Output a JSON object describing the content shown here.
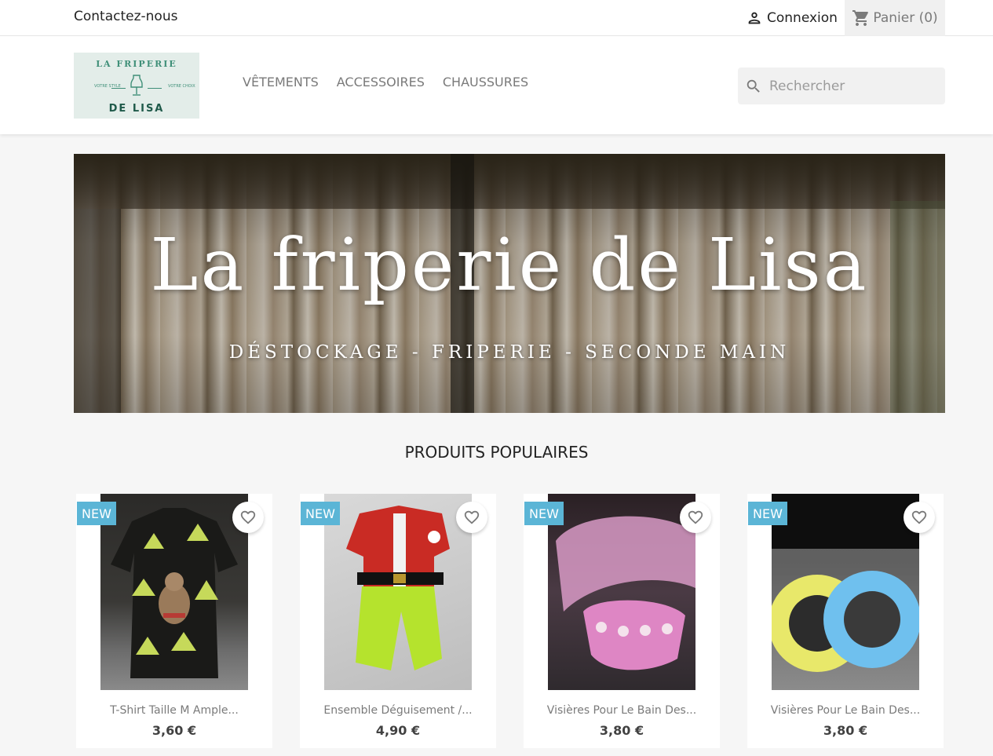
{
  "topbar": {
    "contact": "Contactez-nous",
    "login": "Connexion",
    "cart": "Panier (0)"
  },
  "header": {
    "logo": {
      "top": "LA FRIPERIE",
      "bottom": "DE LISA",
      "left_small": "VOTRE STYLE",
      "right_small": "VOTRE CHOIX"
    },
    "menu": [
      "VÊTEMENTS",
      "ACCESSOIRES",
      "CHAUSSURES"
    ],
    "search_placeholder": "Rechercher"
  },
  "banner": {
    "title": "La friperie de Lisa",
    "subtitle": "DÉSTOCKAGE - FRIPERIE - SECONDE MAIN"
  },
  "section_title": "PRODUITS POPULAIRES",
  "products": [
    {
      "badge": "NEW",
      "name": "T-Shirt Taille M Ample...",
      "price": "3,60 €"
    },
    {
      "badge": "NEW",
      "name": "Ensemble Déguisement /...",
      "price": "4,90 €"
    },
    {
      "badge": "NEW",
      "name": "Visières Pour Le Bain Des...",
      "price": "3,80 €"
    },
    {
      "badge": "NEW",
      "name": "Visières Pour Le Bain Des...",
      "price": "3,80 €"
    }
  ],
  "colors": {
    "badge": "#5bb5d6",
    "accent": "#7a7a7a"
  },
  "icons": {
    "login": "person-icon",
    "cart": "cart-icon",
    "search": "search-icon",
    "favorite": "heart-icon"
  }
}
